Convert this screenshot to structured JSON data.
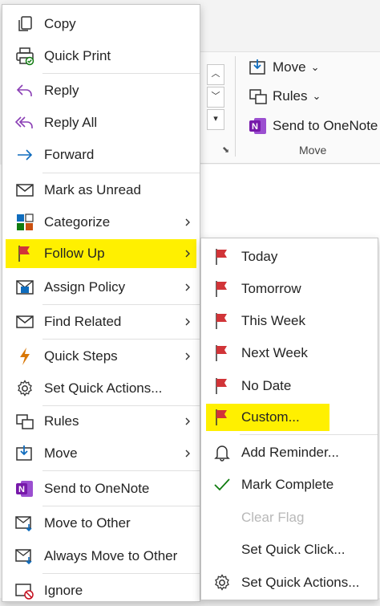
{
  "ribbon": {
    "move_label": "Move",
    "rules_label": "Rules",
    "onenote_label": "Send to OneNote",
    "group_label": "Move",
    "dropdown_glyph": "⌄"
  },
  "menu": {
    "items": [
      {
        "label": "Copy",
        "icon": "copy-icon"
      },
      {
        "label": "Quick Print",
        "icon": "quick-print-icon"
      },
      {
        "label": "Reply",
        "icon": "reply-icon"
      },
      {
        "label": "Reply All",
        "icon": "reply-all-icon"
      },
      {
        "label": "Forward",
        "icon": "forward-icon"
      },
      {
        "label": "Mark as Unread",
        "icon": "envelope-icon"
      },
      {
        "label": "Categorize",
        "icon": "categorize-icon"
      },
      {
        "label": "Follow Up",
        "icon": "flag-icon"
      },
      {
        "label": "Assign Policy",
        "icon": "policy-icon"
      },
      {
        "label": "Find Related",
        "icon": "find-related-icon"
      },
      {
        "label": "Quick Steps",
        "icon": "lightning-icon"
      },
      {
        "label": "Set Quick Actions...",
        "icon": "gear-icon"
      },
      {
        "label": "Rules",
        "icon": "rules-icon"
      },
      {
        "label": "Move",
        "icon": "move-icon"
      },
      {
        "label": "Send to OneNote",
        "icon": "onenote-icon"
      },
      {
        "label": "Move to Other",
        "icon": "move-to-other-icon"
      },
      {
        "label": "Always Move to Other",
        "icon": "always-move-icon"
      },
      {
        "label": "Ignore",
        "icon": "ignore-icon"
      }
    ]
  },
  "submenu": {
    "items": [
      {
        "label": "Today",
        "icon": "flag-icon"
      },
      {
        "label": "Tomorrow",
        "icon": "flag-icon"
      },
      {
        "label": "This Week",
        "icon": "flag-icon"
      },
      {
        "label": "Next Week",
        "icon": "flag-icon"
      },
      {
        "label": "No Date",
        "icon": "flag-icon"
      },
      {
        "label": "Custom...",
        "icon": "flag-icon"
      },
      {
        "label": "Add Reminder...",
        "icon": "bell-icon"
      },
      {
        "label": "Mark Complete",
        "icon": "checkmark-icon"
      },
      {
        "label": "Clear Flag",
        "icon": ""
      },
      {
        "label": "Set Quick Click...",
        "icon": ""
      },
      {
        "label": "Set Quick Actions...",
        "icon": "gear-icon"
      }
    ]
  },
  "colors": {
    "highlight": "#fff000",
    "flag_red": "#d13438",
    "accent_blue": "#0f6cbd",
    "onenote_purple": "#7719aa",
    "check_green": "#107c10",
    "lightning_orange": "#d97706"
  }
}
